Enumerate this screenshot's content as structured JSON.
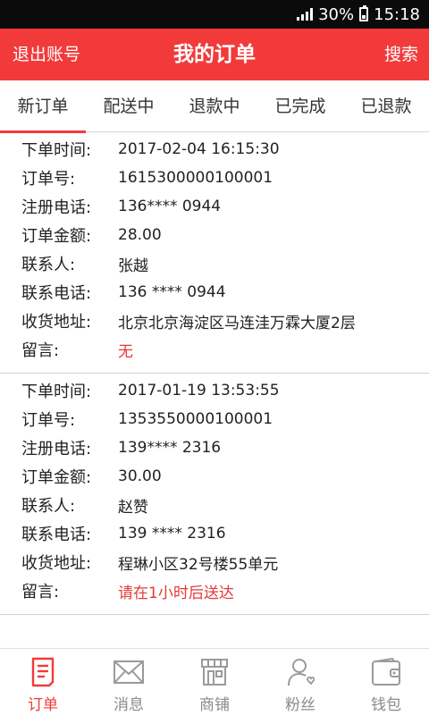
{
  "status_bar": {
    "battery": "30%",
    "time": "15:18"
  },
  "header": {
    "logout": "退出账号",
    "title": "我的订单",
    "search": "搜索"
  },
  "tabs": [
    "新订单",
    "配送中",
    "退款中",
    "已完成",
    "已退款"
  ],
  "labels": {
    "order_time": "下单时间:",
    "order_no": "订单号:",
    "reg_phone": "注册电话:",
    "amount": "订单金额:",
    "contact": "联系人:",
    "contact_phone": "联系电话:",
    "address": "收货地址:",
    "message": "留言:"
  },
  "orders": [
    {
      "order_time": "2017-02-04 16:15:30",
      "order_no": "1615300000100001",
      "reg_phone": "136**** 0944",
      "amount": "28.00",
      "contact": "张越",
      "contact_phone": "136 **** 0944",
      "address": "北京北京海淀区马连洼万霖大厦2层",
      "message": "无"
    },
    {
      "order_time": "2017-01-19 13:53:55",
      "order_no": "1353550000100001",
      "reg_phone": "139**** 2316",
      "amount": "30.00",
      "contact": "赵赞",
      "contact_phone": "139 **** 2316",
      "address": "程琳小区32号楼55单元",
      "message": "请在1小时后送达"
    }
  ],
  "bottom_nav": [
    {
      "label": "订单",
      "icon": "order-icon"
    },
    {
      "label": "消息",
      "icon": "message-icon"
    },
    {
      "label": "商铺",
      "icon": "shop-icon"
    },
    {
      "label": "粉丝",
      "icon": "fans-icon"
    },
    {
      "label": "钱包",
      "icon": "wallet-icon"
    }
  ],
  "colors": {
    "accent": "#f23a3a",
    "status_bar": "#0b0b0b",
    "message_text": "#e53935"
  }
}
